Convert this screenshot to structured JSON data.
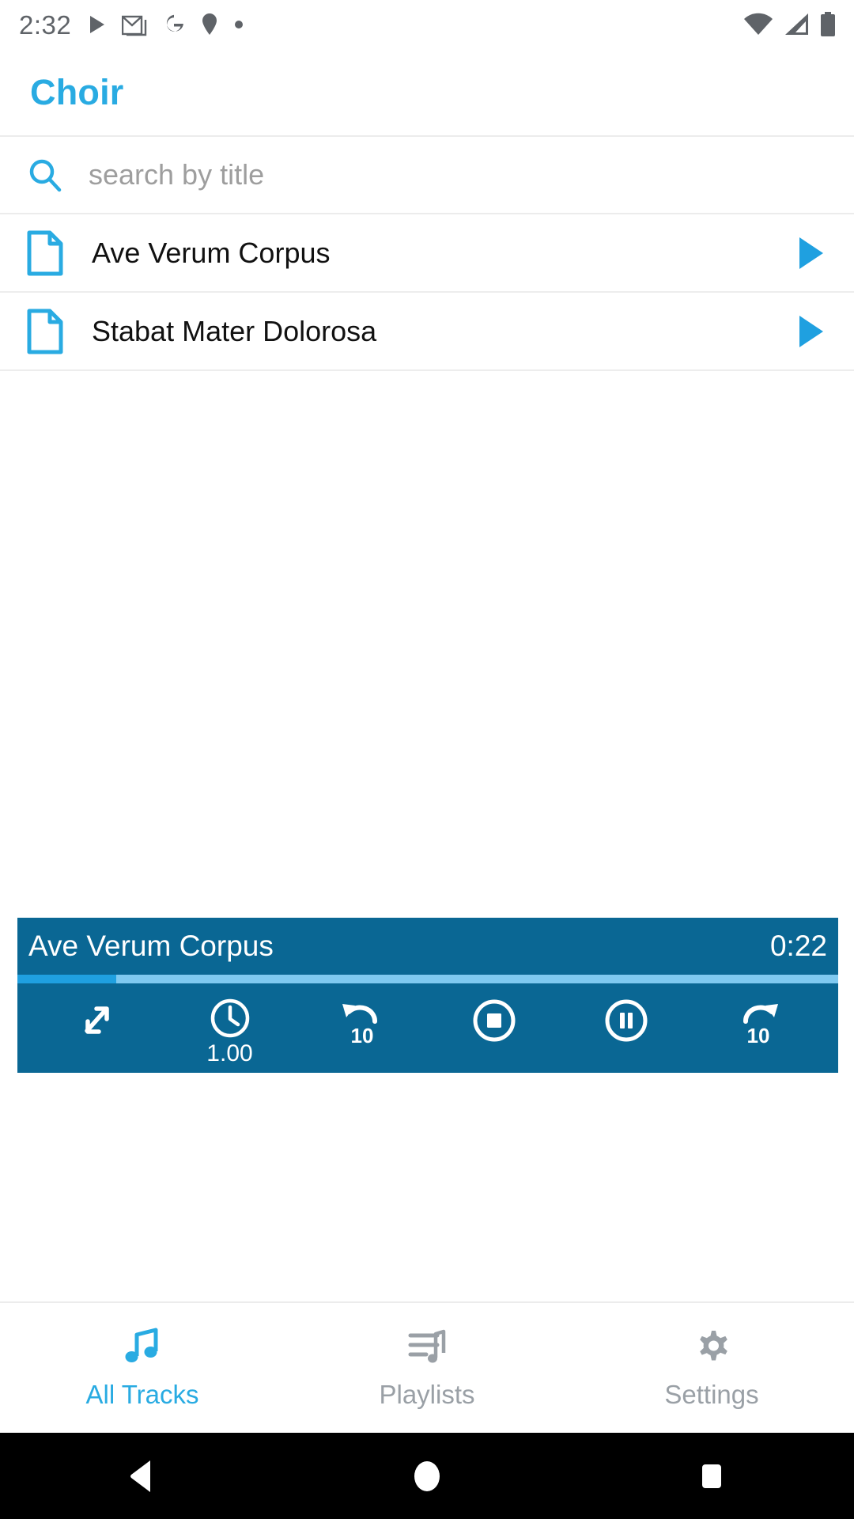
{
  "status_bar": {
    "time": "2:32",
    "notification_icons": [
      "play-icon",
      "gmail-icon",
      "google-icon",
      "location-pin-icon",
      "dot-icon"
    ],
    "system_icons": [
      "wifi-icon",
      "cellular-signal-icon",
      "battery-icon"
    ]
  },
  "app_bar": {
    "title": "Choir",
    "title_color": "#29ABE2"
  },
  "search": {
    "placeholder": "search by title",
    "value": "",
    "icon": "search-icon"
  },
  "track_list": {
    "items": [
      {
        "title": "Ave Verum Corpus",
        "file_icon": "document-icon",
        "action_icon": "play-icon"
      },
      {
        "title": "Stabat Mater Dolorosa",
        "file_icon": "document-icon",
        "action_icon": "play-icon"
      }
    ]
  },
  "player": {
    "now_playing": "Ave Verum Corpus",
    "elapsed_time": "0:22",
    "progress_percent": 12,
    "background_color": "#0a6794",
    "progress_fill_color": "#1FA0E0",
    "progress_track_color": "#7FC9F0",
    "controls": [
      {
        "name": "expand",
        "icon": "expand-arrows-icon",
        "label": ""
      },
      {
        "name": "speed",
        "icon": "clock-icon",
        "label": "1.00"
      },
      {
        "name": "rewind",
        "icon": "replay-10-icon",
        "label": ""
      },
      {
        "name": "stop",
        "icon": "stop-circle-icon",
        "label": ""
      },
      {
        "name": "pause",
        "icon": "pause-circle-icon",
        "label": ""
      },
      {
        "name": "forward",
        "icon": "forward-10-icon",
        "label": ""
      }
    ]
  },
  "bottom_nav": {
    "active_color": "#29ABE2",
    "inactive_color": "#9aa0a6",
    "items": [
      {
        "label": "All Tracks",
        "icon": "music-note-icon",
        "active": true
      },
      {
        "label": "Playlists",
        "icon": "queue-music-icon",
        "active": false
      },
      {
        "label": "Settings",
        "icon": "gear-icon",
        "active": false
      }
    ]
  },
  "system_nav": {
    "buttons": [
      "back-icon",
      "home-icon",
      "recents-icon"
    ]
  }
}
